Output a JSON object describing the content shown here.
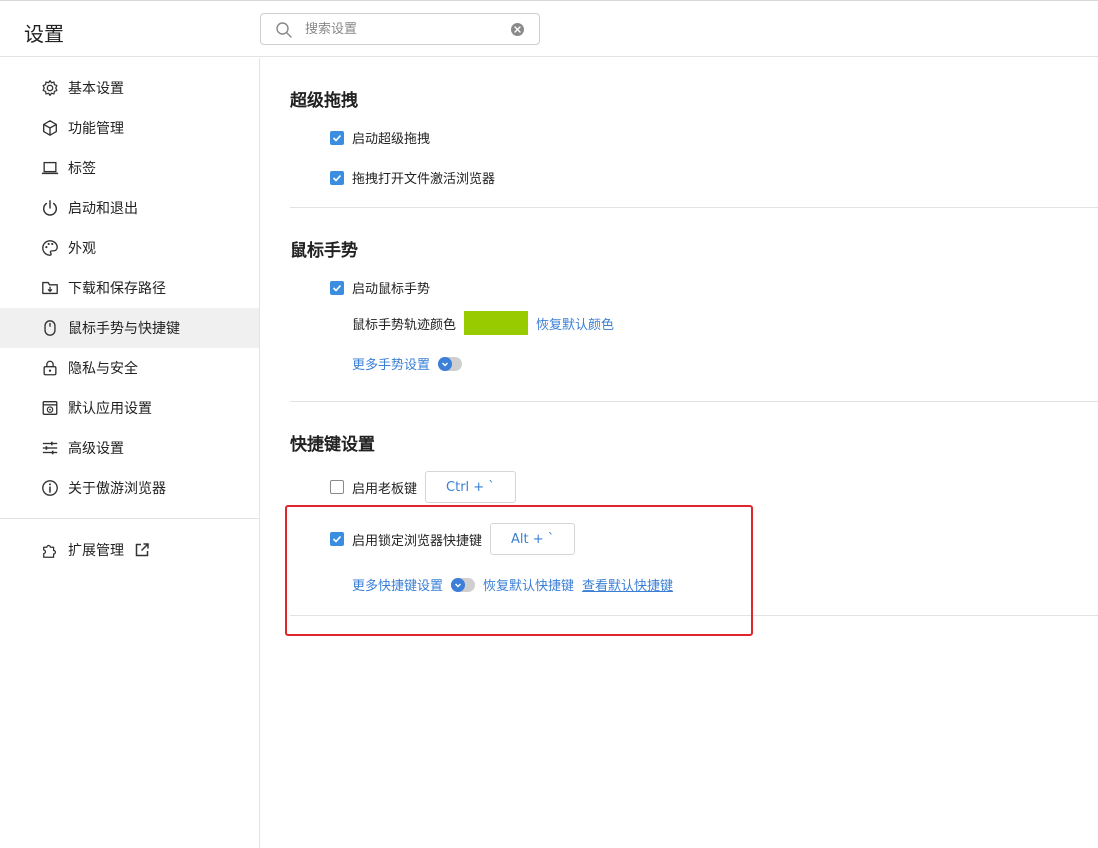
{
  "header": {
    "title": "设置",
    "search_placeholder": "搜索设置"
  },
  "sidebar": {
    "items": [
      {
        "label": "基本设置",
        "icon": "gear-icon",
        "active": false
      },
      {
        "label": "功能管理",
        "icon": "cube-icon",
        "active": false
      },
      {
        "label": "标签",
        "icon": "laptop-icon",
        "active": false
      },
      {
        "label": "启动和退出",
        "icon": "power-icon",
        "active": false
      },
      {
        "label": "外观",
        "icon": "palette-icon",
        "active": false
      },
      {
        "label": "下载和保存路径",
        "icon": "download-folder-icon",
        "active": false
      },
      {
        "label": "鼠标手势与快捷键",
        "icon": "mouse-icon",
        "active": true
      },
      {
        "label": "隐私与安全",
        "icon": "lock-icon",
        "active": false
      },
      {
        "label": "默认应用设置",
        "icon": "default-app-icon",
        "active": false
      },
      {
        "label": "高级设置",
        "icon": "sliders-icon",
        "active": false
      },
      {
        "label": "关于傲游浏览器",
        "icon": "info-icon",
        "active": false
      }
    ],
    "extensions": {
      "label": "扩展管理",
      "icon": "puzzle-icon",
      "link_icon": "external-link-icon"
    }
  },
  "main": {
    "super_drag": {
      "title": "超级拖拽",
      "enable_label": "启动超级拖拽",
      "enable_checked": true,
      "activate_label": "拖拽打开文件激活浏览器",
      "activate_checked": true
    },
    "mouse_gesture": {
      "title": "鼠标手势",
      "enable_label": "启动鼠标手势",
      "enable_checked": true,
      "trail_color_label": "鼠标手势轨迹颜色",
      "trail_color": "#99cc00",
      "restore_color_label": "恢复默认颜色",
      "more_label": "更多手势设置"
    },
    "shortcuts": {
      "title": "快捷键设置",
      "boss_key_label": "启用老板键",
      "boss_key_checked": false,
      "boss_key_value": "Ctrl + `",
      "lock_key_label": "启用锁定浏览器快捷键",
      "lock_key_checked": true,
      "lock_key_value": "Alt + `",
      "more_label": "更多快捷键设置",
      "restore_label": "恢复默认快捷键",
      "view_label": "查看默认快捷键"
    }
  },
  "colors": {
    "accent": "#3b8de0",
    "link": "#3a7fd5",
    "highlight_border": "#e0262a",
    "active_bg": "#f0f0f0"
  }
}
